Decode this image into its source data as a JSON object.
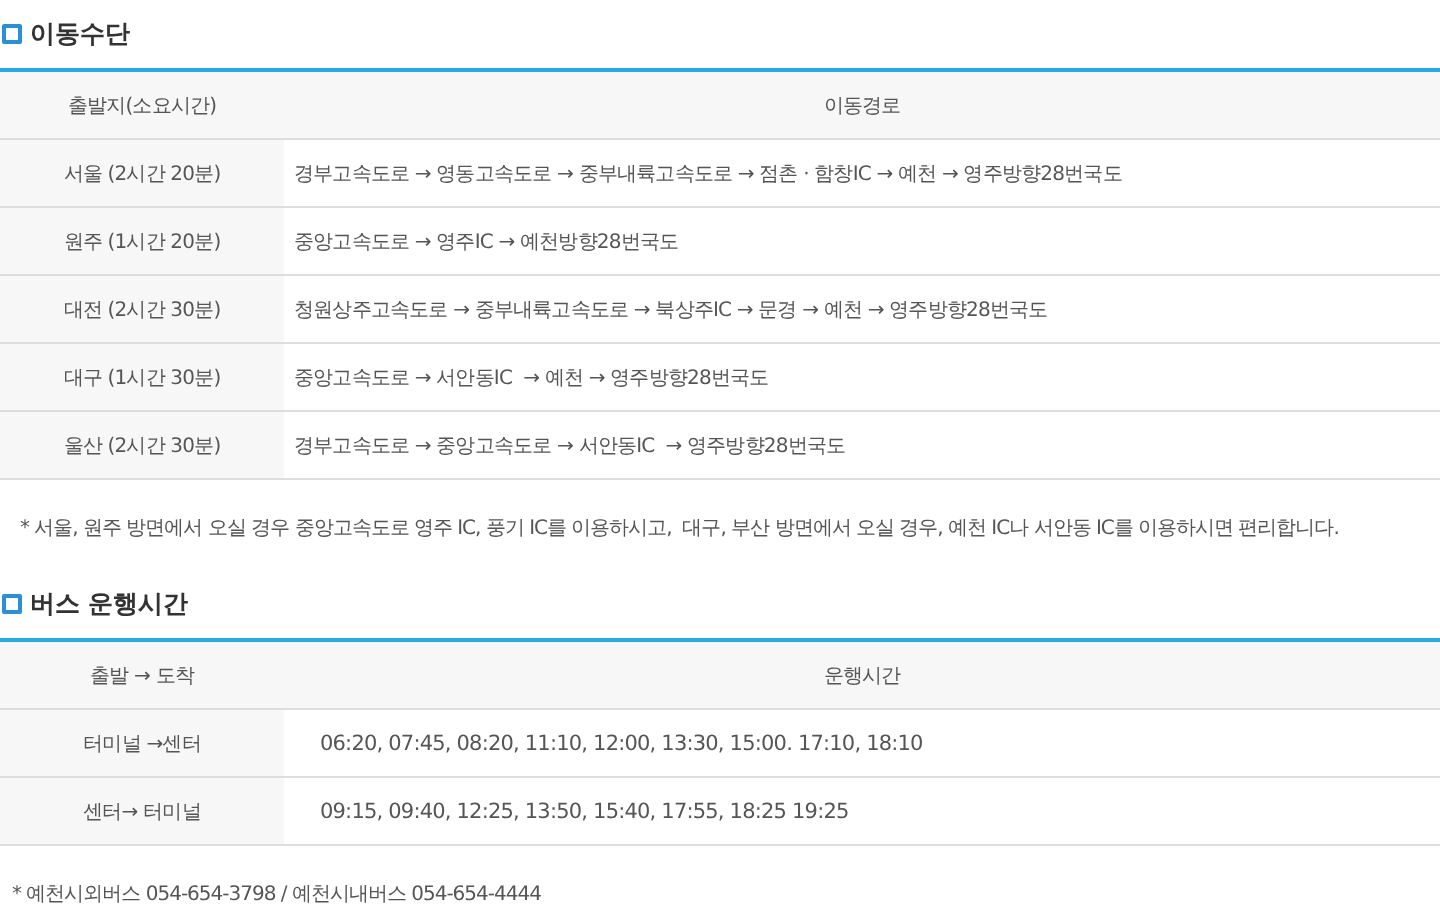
{
  "sections": [
    {
      "kind": "routes",
      "title": "이동수단",
      "columns": [
        "출발지(소요시간)",
        "이동경로"
      ],
      "rows": [
        {
          "origin": "서울 (2시간 20분)",
          "route": "경부고속도로 → 영동고속도로 → 중부내륙고속도로 → 점촌 · 함창IC → 예천 → 영주방향28번국도"
        },
        {
          "origin": "원주 (1시간 20분)",
          "route": "중앙고속도로 → 영주IC → 예천방향28번국도"
        },
        {
          "origin": "대전 (2시간 30분)",
          "route": "청원상주고속도로 → 중부내륙고속도로 → 북상주IC → 문경 → 예천 → 영주방향28번국도"
        },
        {
          "origin": "대구 (1시간 30분)",
          "route": "중앙고속도로 → 서안동IC  → 예천 → 영주방향28번국도"
        },
        {
          "origin": "울산 (2시간 30분)",
          "route": "경부고속도로 → 중앙고속도로 → 서안동IC  → 영주방향28번국도"
        }
      ],
      "note": "* 서울, 원주 방면에서 오실 경우 중앙고속도로 영주 IC, 풍기 IC를 이용하시고,  대구, 부산 방면에서 오실 경우, 예천 IC나 서안동 IC를 이용하시면 편리합니다."
    },
    {
      "kind": "bus",
      "title": "버스 운행시간",
      "columns": [
        "출발 →  도착",
        "운행시간"
      ],
      "rows": [
        {
          "origin": "터미널 →센터",
          "route": "06:20, 07:45, 08:20, 11:10, 12:00, 13:30, 15:00. 17:10, 18:10"
        },
        {
          "origin": "센터→ 터미널",
          "route": "09:15, 09:40, 12:25, 13:50, 15:40, 17:55, 18:25 19:25"
        }
      ],
      "note": "* 예천시외버스 054-654-3798 / 예천시내버스 054-654-4444"
    }
  ]
}
